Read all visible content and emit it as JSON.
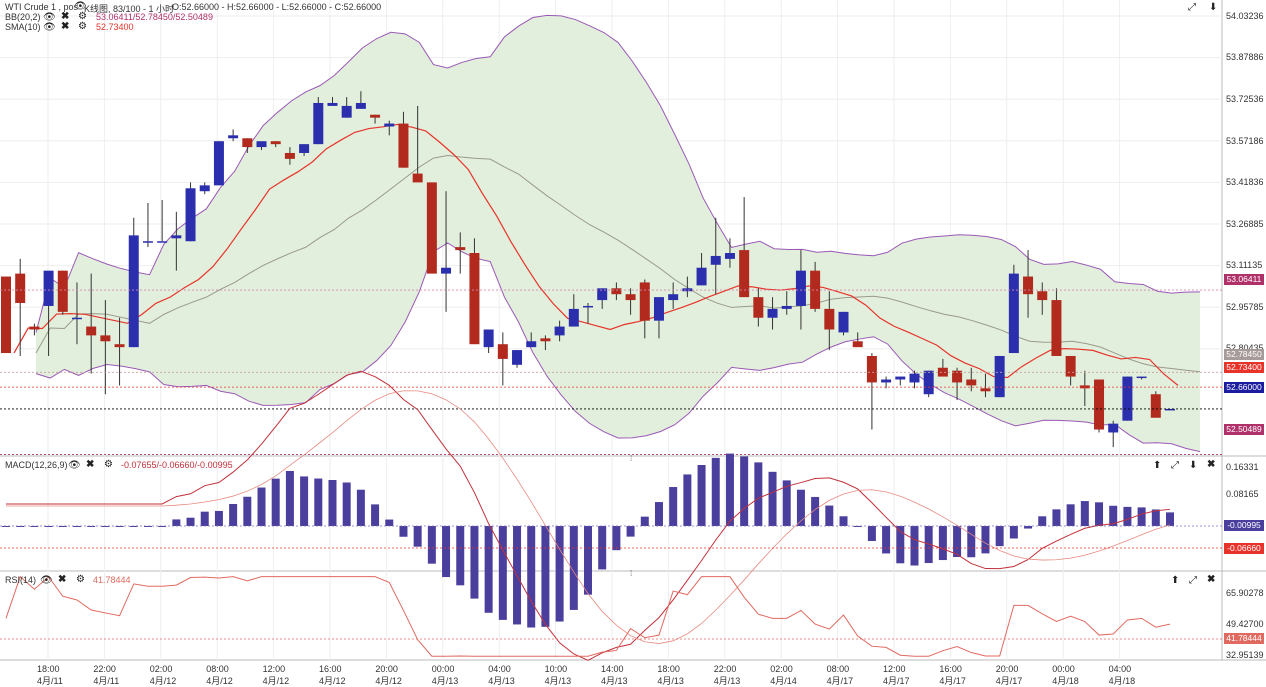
{
  "legend": {
    "instrument": "WTI Crude 1 , pos",
    "chart_type": "K线图, 83/100 - 1 小时",
    "ohlc": "O:52.66000 - H:52.66000 - L:52.66000 - C:52.66000",
    "bb_name": "BB(20,2)",
    "bb_values": "53.06411/52.78450/52.50489",
    "sma_name": "SMA(10)",
    "sma_value": "52.73400",
    "macd_name": "MACD(12,26,9)",
    "macd_values": "-0.07655/-0.06660/-0.00995",
    "rsi_name": "RSI(14)",
    "rsi_value": "41.78444"
  },
  "icons": {
    "eye": "eye-icon",
    "close": "close-icon",
    "settings": "gear-icon",
    "expand": "expand-icon",
    "collapse": "collapse-icon",
    "move_up": "arrow-up-icon",
    "move_down": "arrow-down-icon"
  },
  "colors": {
    "bull": "#2b2fae",
    "bear": "#b22a1e",
    "band_fill": "#e2efdc",
    "band_line": "#9b59b6",
    "sma": "#e8332a",
    "middle": "#9a9a8a",
    "macd_hist": "#4b3f9e",
    "rsi": "#e06a60"
  },
  "price_axis": {
    "ticks": [
      "54.03236",
      "53.87886",
      "53.72536",
      "53.57186",
      "53.41836",
      "53.26885",
      "53.11135",
      "52.95785",
      "52.80435"
    ],
    "tag_upper": "53.06411",
    "tag_middle": "52.78450",
    "tag_sma": "52.73400",
    "tag_last": "52.66000",
    "tag_lower": "52.50489"
  },
  "macd_axis": {
    "ticks": [
      "0.16331",
      "0.08165"
    ],
    "tag_hist": "-0.00995",
    "tag_signal": "-0.06660"
  },
  "rsi_axis": {
    "ticks": [
      "65.90278",
      "49.42700",
      "32.95139"
    ],
    "tag_rsi": "41.78444"
  },
  "time_axis": [
    {
      "time": "18:00",
      "date": "4月/11"
    },
    {
      "time": "22:00",
      "date": "4月/11"
    },
    {
      "time": "02:00",
      "date": "4月/12"
    },
    {
      "time": "08:00",
      "date": "4月/12"
    },
    {
      "time": "12:00",
      "date": "4月/12"
    },
    {
      "time": "16:00",
      "date": "4月/12"
    },
    {
      "time": "20:00",
      "date": "4月/12"
    },
    {
      "time": "00:00",
      "date": "4月/13"
    },
    {
      "time": "04:00",
      "date": "4月/13"
    },
    {
      "time": "10:00",
      "date": "4月/13"
    },
    {
      "time": "14:00",
      "date": "4月/13"
    },
    {
      "time": "18:00",
      "date": "4月/13"
    },
    {
      "time": "22:00",
      "date": "4月/13"
    },
    {
      "time": "02:00",
      "date": "4月/14"
    },
    {
      "time": "08:00",
      "date": "4月/17"
    },
    {
      "time": "12:00",
      "date": "4月/17"
    },
    {
      "time": "16:00",
      "date": "4月/17"
    },
    {
      "time": "20:00",
      "date": "4月/17"
    },
    {
      "time": "00:00",
      "date": "4月/18"
    },
    {
      "time": "04:00",
      "date": "4月/18"
    }
  ],
  "chart_data": {
    "type": "candlestick",
    "candles": [
      [
        53.11,
        53.11,
        52.85,
        52.85
      ],
      [
        53.12,
        53.17,
        52.84,
        53.02
      ],
      [
        52.94,
        52.95,
        52.91,
        52.93
      ],
      [
        53.01,
        53.12,
        52.84,
        53.13
      ],
      [
        53.13,
        53.13,
        52.98,
        52.99
      ],
      [
        52.97,
        53.09,
        52.88,
        52.97
      ],
      [
        52.94,
        53.12,
        52.78,
        52.91
      ],
      [
        52.91,
        53.03,
        52.71,
        52.89
      ],
      [
        52.88,
        52.97,
        52.74,
        52.87
      ],
      [
        52.87,
        53.31,
        52.87,
        53.25
      ],
      [
        53.23,
        53.36,
        53.21,
        53.23
      ],
      [
        53.23,
        53.37,
        53.23,
        53.23
      ],
      [
        53.24,
        53.33,
        53.13,
        53.25
      ],
      [
        53.23,
        53.43,
        53.23,
        53.41
      ],
      [
        53.4,
        53.43,
        53.39,
        53.42
      ],
      [
        53.42,
        53.57,
        53.42,
        53.57
      ],
      [
        53.58,
        53.61,
        53.57,
        53.59
      ],
      [
        53.58,
        53.58,
        53.53,
        53.55
      ],
      [
        53.55,
        53.56,
        53.54,
        53.57
      ],
      [
        53.57,
        53.57,
        53.55,
        53.56
      ],
      [
        53.53,
        53.55,
        53.49,
        53.51
      ],
      [
        53.53,
        53.56,
        53.52,
        53.56
      ],
      [
        53.56,
        53.72,
        53.56,
        53.7
      ],
      [
        53.69,
        53.72,
        53.69,
        53.7
      ],
      [
        53.65,
        53.72,
        53.65,
        53.69
      ],
      [
        53.68,
        53.74,
        53.69,
        53.7
      ],
      [
        53.66,
        53.66,
        53.63,
        53.65
      ],
      [
        53.62,
        53.64,
        53.59,
        53.63
      ],
      [
        53.63,
        53.67,
        53.48,
        53.48
      ],
      [
        53.46,
        53.69,
        53.46,
        53.43
      ],
      [
        53.43,
        53.43,
        53.14,
        53.12
      ],
      [
        53.12,
        53.4,
        52.99,
        53.14
      ],
      [
        53.21,
        53.26,
        53.12,
        53.2
      ],
      [
        53.19,
        53.24,
        52.96,
        52.88
      ],
      [
        52.87,
        52.92,
        52.85,
        52.93
      ],
      [
        52.88,
        52.92,
        52.74,
        52.83
      ],
      [
        52.81,
        52.86,
        52.8,
        52.86
      ],
      [
        52.87,
        52.92,
        52.87,
        52.89
      ],
      [
        52.9,
        52.91,
        52.86,
        52.89
      ],
      [
        52.91,
        52.96,
        52.89,
        52.94
      ],
      [
        52.94,
        53.05,
        52.94,
        53.0
      ],
      [
        53.01,
        53.02,
        52.95,
        53.01
      ],
      [
        53.03,
        53.07,
        53.0,
        53.07
      ],
      [
        53.07,
        53.09,
        53.03,
        53.05
      ],
      [
        53.05,
        53.07,
        52.98,
        53.03
      ],
      [
        53.09,
        53.1,
        52.9,
        52.96
      ],
      [
        52.96,
        53.04,
        52.9,
        53.04
      ],
      [
        53.03,
        53.09,
        53.0,
        53.05
      ],
      [
        53.06,
        53.11,
        53.04,
        53.07
      ],
      [
        53.08,
        53.19,
        53.08,
        53.14
      ],
      [
        53.15,
        53.31,
        53.05,
        53.18
      ],
      [
        53.17,
        53.24,
        53.14,
        53.19
      ],
      [
        53.2,
        53.38,
        53.06,
        53.04
      ],
      [
        53.04,
        53.07,
        52.94,
        52.97
      ],
      [
        52.97,
        53.04,
        52.93,
        53.0
      ],
      [
        53.0,
        53.06,
        52.98,
        53.01
      ],
      [
        53.01,
        53.2,
        52.93,
        53.13
      ],
      [
        53.13,
        53.16,
        52.99,
        53.0
      ],
      [
        53.0,
        53.06,
        52.86,
        52.93
      ],
      [
        52.92,
        52.99,
        52.91,
        52.99
      ],
      [
        52.89,
        52.92,
        52.88,
        52.87
      ],
      [
        52.84,
        52.85,
        52.59,
        52.75
      ],
      [
        52.75,
        52.77,
        52.73,
        52.76
      ],
      [
        52.76,
        52.77,
        52.74,
        52.77
      ],
      [
        52.75,
        52.79,
        52.73,
        52.78
      ],
      [
        52.71,
        52.79,
        52.7,
        52.79
      ],
      [
        52.8,
        52.83,
        52.79,
        52.77
      ],
      [
        52.79,
        52.8,
        52.69,
        52.75
      ],
      [
        52.76,
        52.8,
        52.72,
        52.74
      ],
      [
        52.73,
        52.78,
        52.7,
        52.72
      ],
      [
        52.7,
        52.84,
        52.7,
        52.84
      ],
      [
        52.85,
        53.15,
        52.85,
        53.12
      ],
      [
        53.11,
        53.2,
        52.97,
        53.05
      ],
      [
        53.06,
        53.09,
        52.98,
        53.03
      ],
      [
        53.03,
        53.07,
        52.91,
        52.84
      ],
      [
        52.84,
        52.82,
        52.74,
        52.77
      ],
      [
        52.74,
        52.79,
        52.67,
        52.73
      ],
      [
        52.76,
        52.74,
        52.58,
        52.59
      ],
      [
        52.58,
        52.62,
        52.53,
        52.61
      ],
      [
        52.62,
        52.77,
        52.62,
        52.77
      ],
      [
        52.77,
        52.77,
        52.76,
        52.77
      ],
      [
        52.71,
        52.72,
        52.64,
        52.63
      ],
      [
        52.66,
        52.66,
        52.66,
        52.66
      ]
    ],
    "title": "WTI Crude 1 , pos",
    "subtitle": "K线图, 83/100 - 1 小时",
    "ylim": [
      52.5,
      54.05
    ],
    "grid": true,
    "legend_position": "top-left"
  }
}
